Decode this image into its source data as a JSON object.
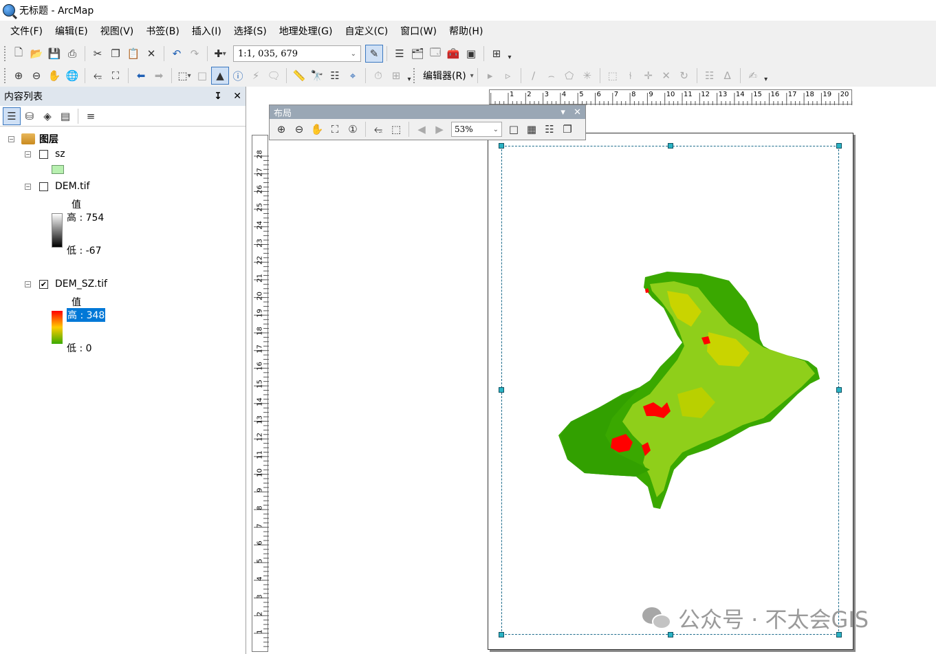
{
  "window": {
    "title": "无标题 - ArcMap"
  },
  "menu": [
    "文件(F)",
    "编辑(E)",
    "视图(V)",
    "书签(B)",
    "插入(I)",
    "选择(S)",
    "地理处理(G)",
    "自定义(C)",
    "窗口(W)",
    "帮助(H)"
  ],
  "toolbar1": {
    "scale_value": "1:1, 035, 679"
  },
  "toolbar2": {
    "editor_label": "编辑器(R)"
  },
  "toc": {
    "title": "内容列表",
    "root_label": "图层",
    "layers": [
      {
        "name": "sz",
        "checked": false,
        "swatch_color": "#b8f0b0"
      },
      {
        "name": "DEM.tif",
        "checked": false,
        "value_label": "值",
        "high_label": "高 : 754",
        "low_label": "低 : -67"
      },
      {
        "name": "DEM_SZ.tif",
        "checked": true,
        "value_label": "值",
        "high_label": "高 : 348",
        "low_label": "低 : 0"
      }
    ]
  },
  "layout_toolbar": {
    "title": "布局",
    "zoom_value": "53%"
  },
  "ruler_h": [
    "1",
    "2",
    "3",
    "4",
    "5",
    "6",
    "7",
    "8",
    "9",
    "10",
    "11",
    "12",
    "13",
    "14",
    "15",
    "16",
    "17",
    "18",
    "19",
    "20"
  ],
  "ruler_v": [
    "28",
    "27",
    "26",
    "25",
    "24",
    "23",
    "22",
    "21",
    "20",
    "19",
    "18",
    "17",
    "16",
    "15",
    "14",
    "13",
    "12",
    "11",
    "10",
    "9",
    "8",
    "7",
    "6",
    "5",
    "4",
    "3",
    "2",
    "1"
  ],
  "watermark": {
    "text": "公众号 · 不太会GIS"
  },
  "colors": {
    "selection": "#0078d7",
    "map_green": "#3aaa00",
    "map_yellow": "#d9d000",
    "map_red": "#ff0000"
  }
}
